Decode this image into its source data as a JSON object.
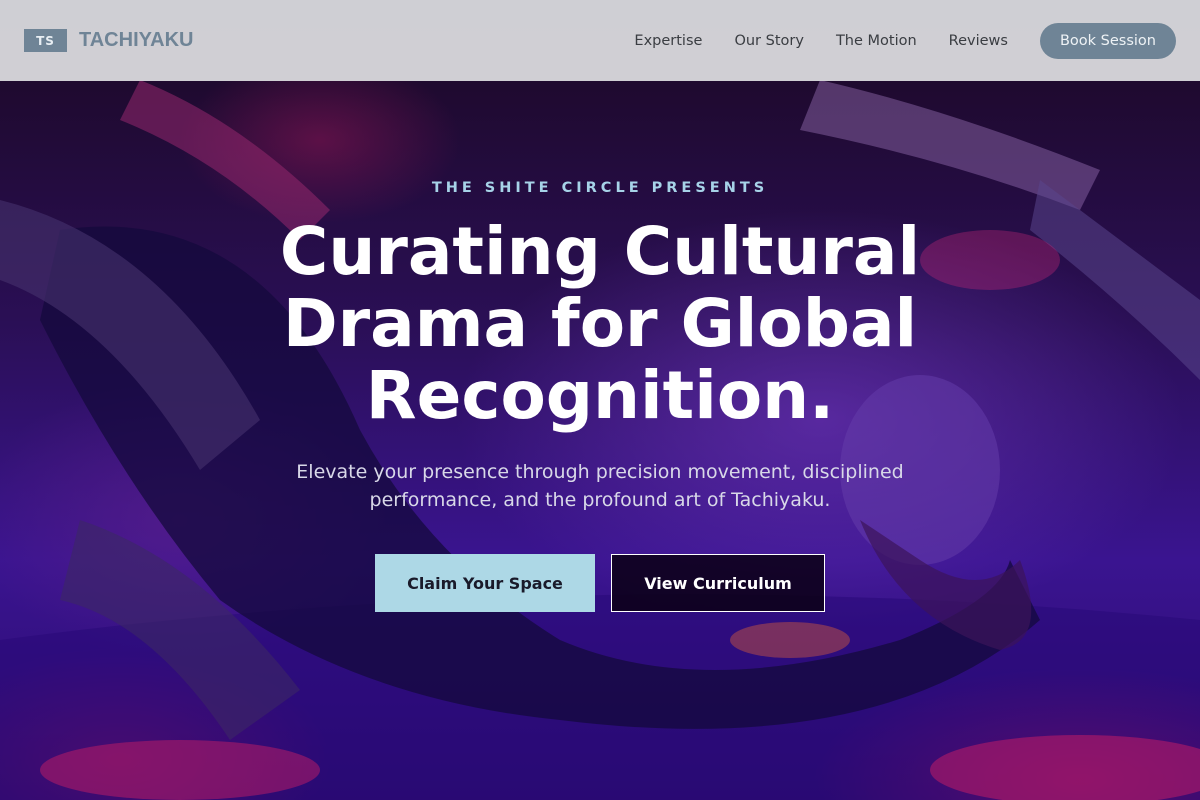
{
  "nav": {
    "logo_badge": "TS",
    "logo_text": "TACHIYAKU",
    "links": [
      "Expertise",
      "Our Story",
      "The Motion",
      "Reviews"
    ],
    "cta": "Book Session"
  },
  "hero": {
    "eyebrow": "THE SHITE CIRCLE PRESENTS",
    "headline": "Curating Cultural Drama for Global Recognition.",
    "subhead": "Elevate your presence through precision movement, disciplined performance, and the profound art of Tachiyaku.",
    "primary_cta": "Claim Your Space",
    "secondary_cta": "View Curriculum"
  },
  "colors": {
    "nav_bg": "#d6d6da",
    "brand": "#6f8496",
    "eyebrow": "#a7d3e8",
    "primary_button": "#add8e6",
    "hero_purple": "#3a1490",
    "hero_magenta": "#c81458"
  }
}
